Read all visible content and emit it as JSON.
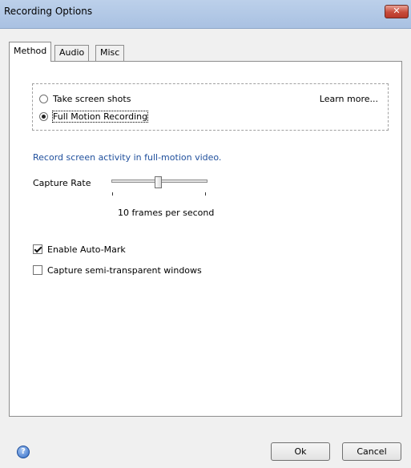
{
  "window": {
    "title": "Recording Options",
    "close_glyph": "✕"
  },
  "tabs": [
    {
      "label": "Method",
      "active": true
    },
    {
      "label": "Audio",
      "active": false
    },
    {
      "label": "Misc",
      "active": false
    }
  ],
  "method": {
    "options": [
      {
        "label": "Take screen shots",
        "selected": false
      },
      {
        "label": "Full Motion Recording",
        "selected": true
      }
    ],
    "learn_more": "Learn more..."
  },
  "description": "Record screen activity in full-motion video.",
  "capture_rate": {
    "label": "Capture Rate",
    "value_fraction": 0.48,
    "value_label": "10 frames per second"
  },
  "checkboxes": [
    {
      "label": "Enable Auto-Mark",
      "checked": true
    },
    {
      "label": "Capture semi-transparent windows",
      "checked": false
    }
  ],
  "footer": {
    "help_icon": "help-icon",
    "help_glyph": "?",
    "ok_label": "Ok",
    "cancel_label": "Cancel"
  }
}
